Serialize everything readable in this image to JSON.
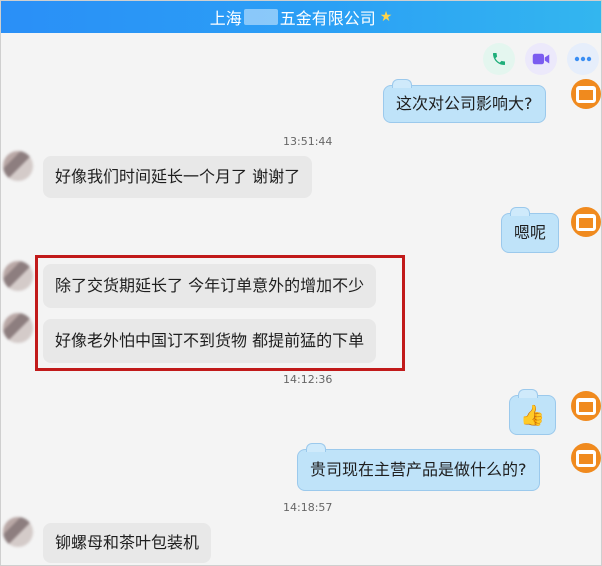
{
  "header": {
    "title_left": "上海",
    "title_right": "五金有限公司",
    "star_icon": "star-icon"
  },
  "toolbar": {
    "phone_icon": "phone-icon",
    "video_icon": "video-icon",
    "more_icon": "more-icon"
  },
  "messages": [
    {
      "side": "right",
      "text": "这次对公司影响大?"
    },
    {
      "side": "left",
      "text": "好像我们时间延长一个月了 谢谢了"
    },
    {
      "side": "right",
      "text": "嗯呢"
    },
    {
      "side": "left",
      "text": "除了交货期延长了 今年订单意外的增加不少"
    },
    {
      "side": "left",
      "text": "好像老外怕中国订不到货物 都提前猛的下单"
    },
    {
      "side": "right",
      "text": "👍"
    },
    {
      "side": "right",
      "text": "贵司现在主营产品是做什么的?"
    },
    {
      "side": "left",
      "text": "铆螺母和茶叶包装机"
    }
  ],
  "timestamps": [
    "13:51:44",
    "14:12:36",
    "14:18:57"
  ],
  "colors": {
    "accent": "#2a8ff7",
    "highlight_border": "#c11a1a",
    "my_bubble": "#bfe3f9"
  }
}
